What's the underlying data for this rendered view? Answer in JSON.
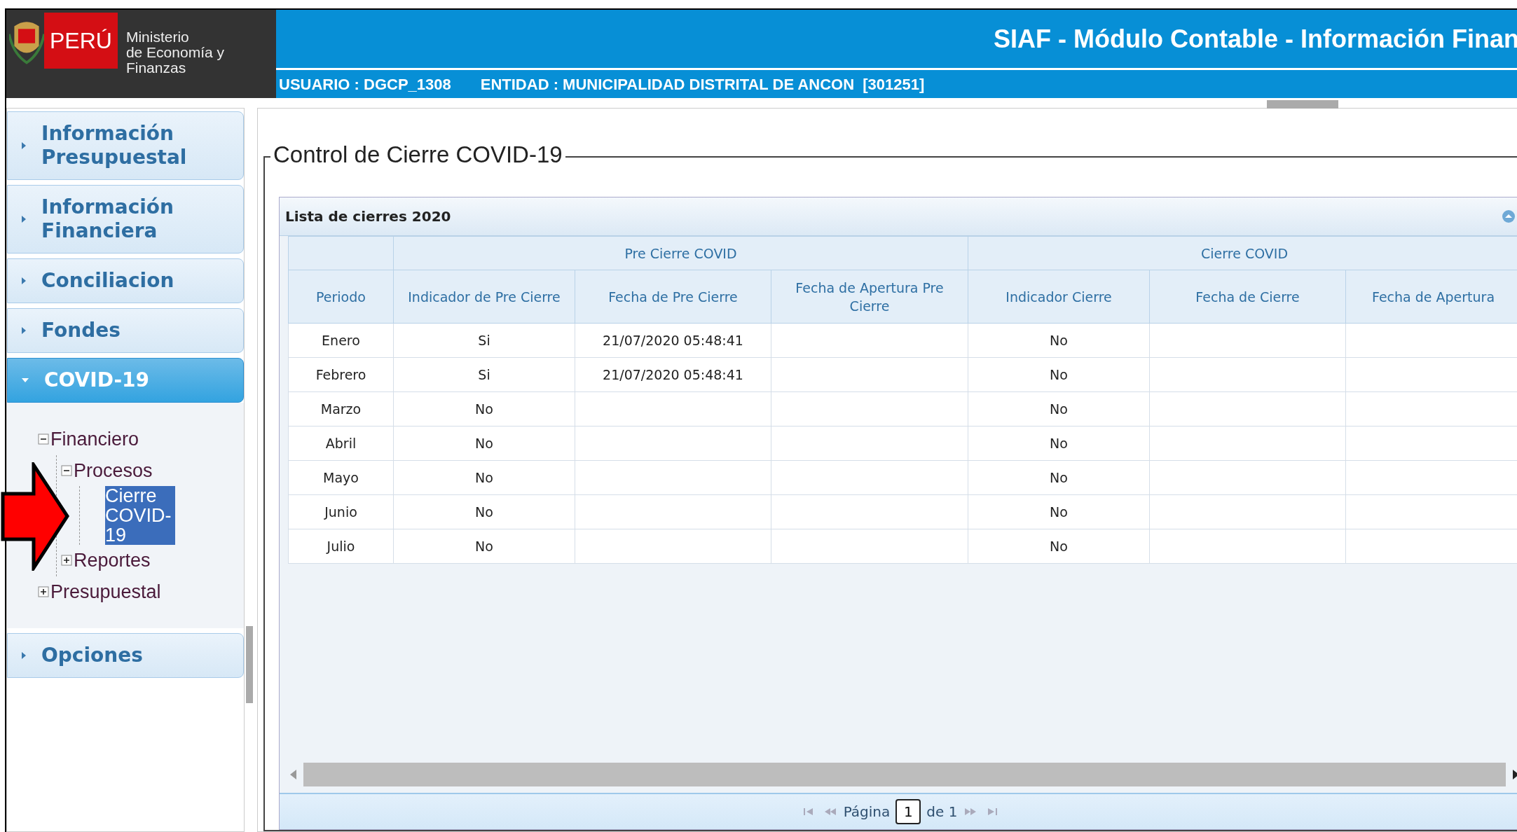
{
  "header": {
    "logo": {
      "country": "PERÚ",
      "line1": "Ministerio",
      "line2": "de Economía y Finanzas"
    },
    "title": "SIAF - Módulo Contable - Información Finan",
    "user": "USUARIO : DGCP_1308",
    "entity": "ENTIDAD : MUNICIPALIDAD DISTRITAL DE ANCON  [301251]"
  },
  "sidebar": {
    "sections": [
      {
        "label": "Información Presupuestal",
        "expanded": false
      },
      {
        "label": "Información Financiera",
        "expanded": false
      },
      {
        "label": "Conciliacion",
        "expanded": false
      },
      {
        "label": "Fondes",
        "expanded": false
      },
      {
        "label": "COVID-19",
        "expanded": true,
        "tree": [
          {
            "label": "Financiero",
            "expanded": true,
            "children": [
              {
                "label": "Procesos",
                "expanded": true,
                "children": [
                  {
                    "label": "Cierre COVID-19",
                    "selected": true
                  }
                ]
              },
              {
                "label": "Reportes",
                "expanded": false
              }
            ]
          },
          {
            "label": "Presupuestal",
            "expanded": false
          }
        ]
      },
      {
        "label": "Opciones",
        "expanded": false
      }
    ]
  },
  "main": {
    "legend": "Control de Cierre COVID-19",
    "grid": {
      "title": "Lista de cierres 2020",
      "groups": [
        "Pre Cierre COVID",
        "Cierre COVID"
      ],
      "columns": [
        "Periodo",
        "Indicador de Pre Cierre",
        "Fecha de Pre Cierre",
        "Fecha de Apertura Pre Cierre",
        "Indicador Cierre",
        "Fecha de Cierre",
        "Fecha de Apertura"
      ],
      "rows": [
        [
          "Enero",
          "Si",
          "21/07/2020 05:48:41",
          "",
          "No",
          "",
          ""
        ],
        [
          "Febrero",
          "Si",
          "21/07/2020 05:48:41",
          "",
          "No",
          "",
          ""
        ],
        [
          "Marzo",
          "No",
          "",
          "",
          "No",
          "",
          ""
        ],
        [
          "Abril",
          "No",
          "",
          "",
          "No",
          "",
          ""
        ],
        [
          "Mayo",
          "No",
          "",
          "",
          "No",
          "",
          ""
        ],
        [
          "Junio",
          "No",
          "",
          "",
          "No",
          "",
          ""
        ],
        [
          "Julio",
          "No",
          "",
          "",
          "No",
          "",
          ""
        ]
      ],
      "pager": {
        "label": "Página",
        "page": "1",
        "total": "de 1"
      }
    }
  }
}
